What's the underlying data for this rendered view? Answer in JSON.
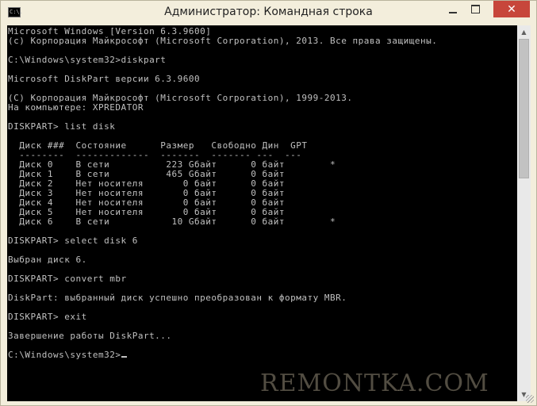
{
  "window": {
    "title": "Администратор: Командная строка",
    "icon": "cmd-icon",
    "icon_text": "C:\\.",
    "close_glyph": "✕"
  },
  "console": {
    "lines": [
      "Microsoft Windows [Version 6.3.9600]",
      "(c) Корпорация Майкрософт (Microsoft Corporation), 2013. Все права защищены.",
      "",
      "C:\\Windows\\system32>diskpart",
      "",
      "Microsoft DiskPart версии 6.3.9600",
      "",
      "(C) Корпорация Майкрософт (Microsoft Corporation), 1999-2013.",
      "На компьютере: XPREDATOR",
      "",
      "DISKPART> list disk",
      "",
      "  Диск ###  Состояние      Размер   Свободно Дин  GPT",
      "  --------  -------------  -------  ------- ---  ---",
      "  Диск 0    В сети          223 Gбайт      0 байт        *",
      "  Диск 1    В сети          465 Gбайт      0 байт",
      "  Диск 2    Нет носителя       0 байт      0 байт",
      "  Диск 3    Нет носителя       0 байт      0 байт",
      "  Диск 4    Нет носителя       0 байт      0 байт",
      "  Диск 5    Нет носителя       0 байт      0 байт",
      "  Диск 6    В сети           10 Gбайт      0 байт        *",
      "",
      "DISKPART> select disk 6",
      "",
      "Выбран диск 6.",
      "",
      "DISKPART> convert mbr",
      "",
      "DiskPart: выбранный диск успешно преобразован к формату MBR.",
      "",
      "DISKPART> exit",
      "",
      "Завершение работы DiskPart...",
      "",
      "C:\\Windows\\system32>"
    ]
  },
  "scrollbar": {
    "position_fraction": 0.0,
    "visible_fraction": 0.4
  },
  "watermark": "REMONTKA.COM"
}
